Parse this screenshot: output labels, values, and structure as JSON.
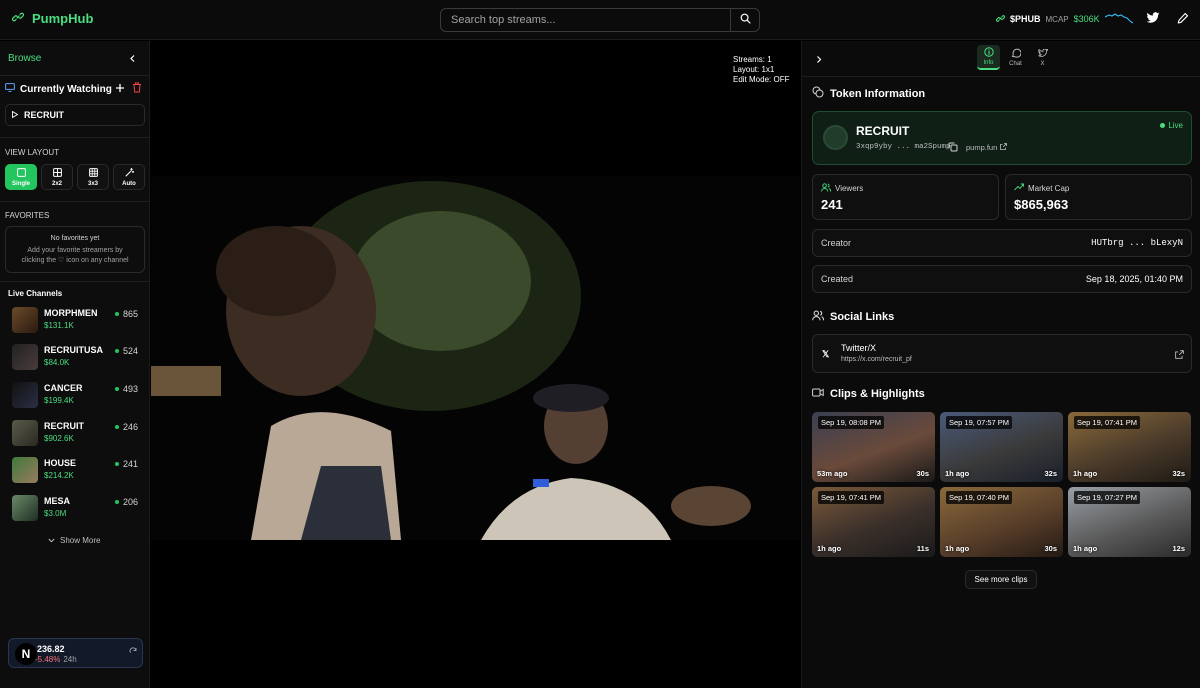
{
  "app": {
    "name": "PumpHub"
  },
  "search": {
    "placeholder": "Search top streams..."
  },
  "header": {
    "token_symbol": "$PHUB",
    "mcap_label": "MCAP",
    "mcap_value": "$306K"
  },
  "sidebar": {
    "browse_label": "Browse",
    "currently_watching_label": "Currently Watching",
    "watching_items": [
      "RECRUIT"
    ],
    "view_layout_label": "VIEW LAYOUT",
    "layout_options": [
      {
        "label": "Single",
        "active": true
      },
      {
        "label": "2x2",
        "active": false
      },
      {
        "label": "3x3",
        "active": false
      },
      {
        "label": "Auto",
        "active": false
      }
    ],
    "favorites_label": "FAVORITES",
    "favorites_empty_title": "No favorites yet",
    "favorites_empty_line1": "Add your favorite streamers by",
    "favorites_empty_line2": "clicking the ♡ icon on any channel",
    "live_channels_label": "Live Channels",
    "live_channels": [
      {
        "name": "MORPHMEN",
        "mcap": "$131.1K",
        "viewers": "865"
      },
      {
        "name": "RECRUITUSA",
        "mcap": "$84.0K",
        "viewers": "524"
      },
      {
        "name": "CANCER",
        "mcap": "$199.4K",
        "viewers": "493"
      },
      {
        "name": "RECRUIT",
        "mcap": "$902.6K",
        "viewers": "246"
      },
      {
        "name": "HOUSE",
        "mcap": "$214.2K",
        "viewers": "241"
      },
      {
        "name": "MESA",
        "mcap": "$3.0M",
        "viewers": "206"
      }
    ],
    "show_more_label": "Show More",
    "ticker": {
      "symbol_letter": "N",
      "price": "236.82",
      "change": "-5.48%",
      "period": "24h"
    }
  },
  "video": {
    "streams_text": "Streams: 1",
    "layout_text": "Layout: 1x1",
    "edit_mode_text": "Edit Mode: OFF"
  },
  "panel": {
    "tabs": [
      {
        "label": "Info",
        "active": true,
        "icon": "info-icon"
      },
      {
        "label": "Chat",
        "active": false,
        "icon": "chat-icon"
      },
      {
        "label": "X",
        "active": false,
        "icon": "twitter-icon"
      }
    ],
    "token_info_title": "Token Information",
    "token": {
      "name": "RECRUIT",
      "address": "3xqp9yby ... ma2Spump",
      "link_label": "pump.fun",
      "status": "Live",
      "viewers_label": "Viewers",
      "viewers_value": "241",
      "market_cap_label": "Market Cap",
      "market_cap_value": "$865,963",
      "creator_label": "Creator",
      "creator_value": "HUTbrg ... bLexyN",
      "created_label": "Created",
      "created_value": "Sep 18, 2025, 01:40 PM"
    },
    "social_title": "Social Links",
    "social": {
      "name": "Twitter/X",
      "url": "https://x.com/recruit_pf"
    },
    "clips_title": "Clips & Highlights",
    "clips": [
      {
        "time": "Sep 19, 08:08 PM",
        "ago": "53m ago",
        "duration": "30s"
      },
      {
        "time": "Sep 19, 07:57 PM",
        "ago": "1h ago",
        "duration": "32s"
      },
      {
        "time": "Sep 19, 07:41 PM",
        "ago": "1h ago",
        "duration": "32s"
      },
      {
        "time": "Sep 19, 07:41 PM",
        "ago": "1h ago",
        "duration": "11s"
      },
      {
        "time": "Sep 19, 07:40 PM",
        "ago": "1h ago",
        "duration": "30s"
      },
      {
        "time": "Sep 19, 07:27 PM",
        "ago": "1h ago",
        "duration": "12s"
      }
    ],
    "see_more_clips": "See more clips"
  },
  "colors": {
    "accent": "#4ade80",
    "brand_green": "#22c55e",
    "negative": "#f87171"
  }
}
